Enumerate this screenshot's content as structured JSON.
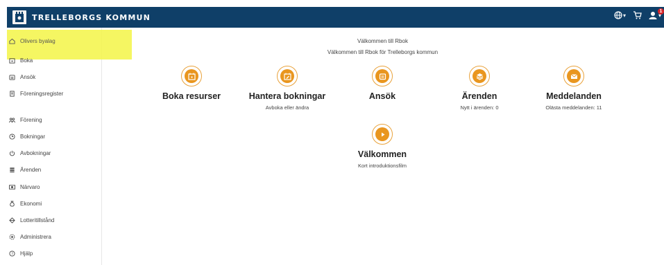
{
  "header": {
    "brand_name": "TRELLEBORGS KOMMUN",
    "background_color": "#0f3f68",
    "icons": [
      "globe-icon",
      "cart-icon",
      "user-icon"
    ],
    "notification_count": "1"
  },
  "sidebar": {
    "items": [
      {
        "label": "Olivers byalag",
        "icon": "home-icon"
      },
      {
        "label": "Boka",
        "icon": "calendar-icon"
      },
      {
        "label": "Ansök",
        "icon": "application-icon"
      },
      {
        "label": "Föreningsregister",
        "icon": "register-icon"
      },
      {
        "label": "Förening",
        "icon": "group-icon"
      },
      {
        "label": "Bokningar",
        "icon": "clock-icon"
      },
      {
        "label": "Avbokningar",
        "icon": "power-icon"
      },
      {
        "label": "Ärenden",
        "icon": "layers-icon"
      },
      {
        "label": "Närvaro",
        "icon": "attendance-icon"
      },
      {
        "label": "Ekonomi",
        "icon": "money-bag-icon"
      },
      {
        "label": "Lotteritillstånd",
        "icon": "lottery-icon"
      },
      {
        "label": "Administrera",
        "icon": "admin-icon"
      },
      {
        "label": "Hjälp",
        "icon": "help-icon"
      }
    ],
    "highlight_color": "#f3f547"
  },
  "main": {
    "welcome_title": "Välkommen till Rbok",
    "welcome_subtitle": "Välkommen till Rbok för Trelleborgs kommun",
    "accent_color": "#e9961f",
    "cards": [
      {
        "title": "Boka resurser",
        "subtitle": "",
        "icon": "calendar-icon"
      },
      {
        "title": "Hantera bokningar",
        "subtitle": "Avboka eller ändra",
        "icon": "calendar-edit-icon"
      },
      {
        "title": "Ansök",
        "subtitle": "",
        "icon": "application-icon"
      },
      {
        "title": "Ärenden",
        "subtitle": "Nytt i ärenden: 0",
        "icon": "layers-icon"
      },
      {
        "title": "Meddelanden",
        "subtitle": "Olästa meddelanden: 11",
        "icon": "envelope-icon"
      },
      {
        "title": "Välkommen",
        "subtitle": "Kort introduktionsfilm",
        "icon": "play-icon"
      }
    ]
  }
}
